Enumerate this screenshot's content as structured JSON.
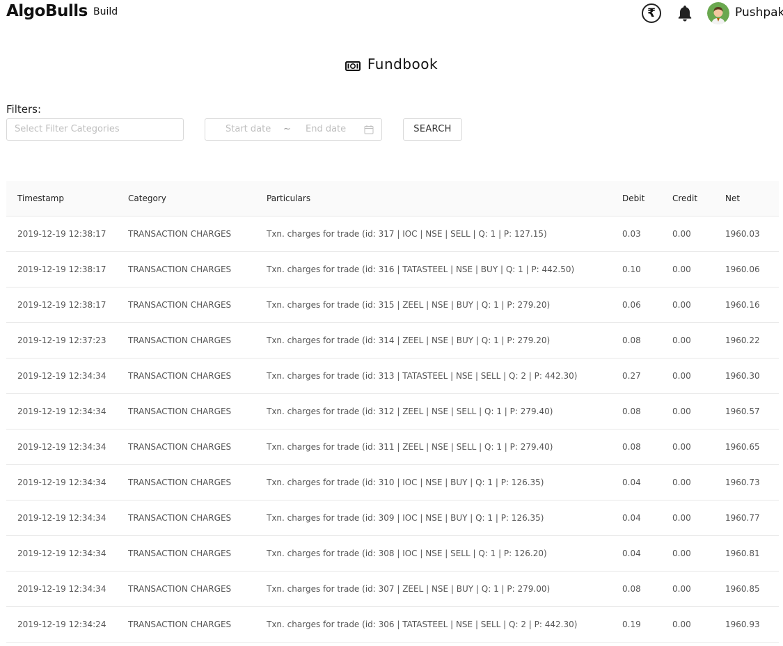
{
  "header": {
    "brand": "AlgoBulls",
    "nav_build": "Build",
    "rupee_symbol": "₹",
    "username": "Pushpak"
  },
  "page": {
    "title": "Fundbook"
  },
  "filters": {
    "label": "Filters:",
    "category_placeholder": "Select Filter Categories",
    "start_date_placeholder": "Start date",
    "separator": "~",
    "end_date_placeholder": "End date",
    "search_label": "SEARCH"
  },
  "table": {
    "columns": [
      "Timestamp",
      "Category",
      "Particulars",
      "Debit",
      "Credit",
      "Net"
    ],
    "rows": [
      [
        "2019-12-19 12:38:17",
        "TRANSACTION CHARGES",
        "Txn. charges for trade (id: 317 | IOC | NSE | SELL | Q: 1 | P: 127.15)",
        "0.03",
        "0.00",
        "1960.03"
      ],
      [
        "2019-12-19 12:38:17",
        "TRANSACTION CHARGES",
        "Txn. charges for trade (id: 316 | TATASTEEL | NSE | BUY | Q: 1 | P: 442.50)",
        "0.10",
        "0.00",
        "1960.06"
      ],
      [
        "2019-12-19 12:38:17",
        "TRANSACTION CHARGES",
        "Txn. charges for trade (id: 315 | ZEEL | NSE | BUY | Q: 1 | P: 279.20)",
        "0.06",
        "0.00",
        "1960.16"
      ],
      [
        "2019-12-19 12:37:23",
        "TRANSACTION CHARGES",
        "Txn. charges for trade (id: 314 | ZEEL | NSE | BUY | Q: 1 | P: 279.20)",
        "0.08",
        "0.00",
        "1960.22"
      ],
      [
        "2019-12-19 12:34:34",
        "TRANSACTION CHARGES",
        "Txn. charges for trade (id: 313 | TATASTEEL | NSE | SELL | Q: 2 | P: 442.30)",
        "0.27",
        "0.00",
        "1960.30"
      ],
      [
        "2019-12-19 12:34:34",
        "TRANSACTION CHARGES",
        "Txn. charges for trade (id: 312 | ZEEL | NSE | SELL | Q: 1 | P: 279.40)",
        "0.08",
        "0.00",
        "1960.57"
      ],
      [
        "2019-12-19 12:34:34",
        "TRANSACTION CHARGES",
        "Txn. charges for trade (id: 311 | ZEEL | NSE | SELL | Q: 1 | P: 279.40)",
        "0.08",
        "0.00",
        "1960.65"
      ],
      [
        "2019-12-19 12:34:34",
        "TRANSACTION CHARGES",
        "Txn. charges for trade (id: 310 | IOC | NSE | BUY | Q: 1 | P: 126.35)",
        "0.04",
        "0.00",
        "1960.73"
      ],
      [
        "2019-12-19 12:34:34",
        "TRANSACTION CHARGES",
        "Txn. charges for trade (id: 309 | IOC | NSE | BUY | Q: 1 | P: 126.35)",
        "0.04",
        "0.00",
        "1960.77"
      ],
      [
        "2019-12-19 12:34:34",
        "TRANSACTION CHARGES",
        "Txn. charges for trade (id: 308 | IOC | NSE | SELL | Q: 1 | P: 126.20)",
        "0.04",
        "0.00",
        "1960.81"
      ],
      [
        "2019-12-19 12:34:34",
        "TRANSACTION CHARGES",
        "Txn. charges for trade (id: 307 | ZEEL | NSE | BUY | Q: 1 | P: 279.00)",
        "0.08",
        "0.00",
        "1960.85"
      ],
      [
        "2019-12-19 12:34:24",
        "TRANSACTION CHARGES",
        "Txn. charges for trade (id: 306 | TATASTEEL | NSE | SELL | Q: 2 | P: 442.30)",
        "0.19",
        "0.00",
        "1960.93"
      ]
    ]
  }
}
